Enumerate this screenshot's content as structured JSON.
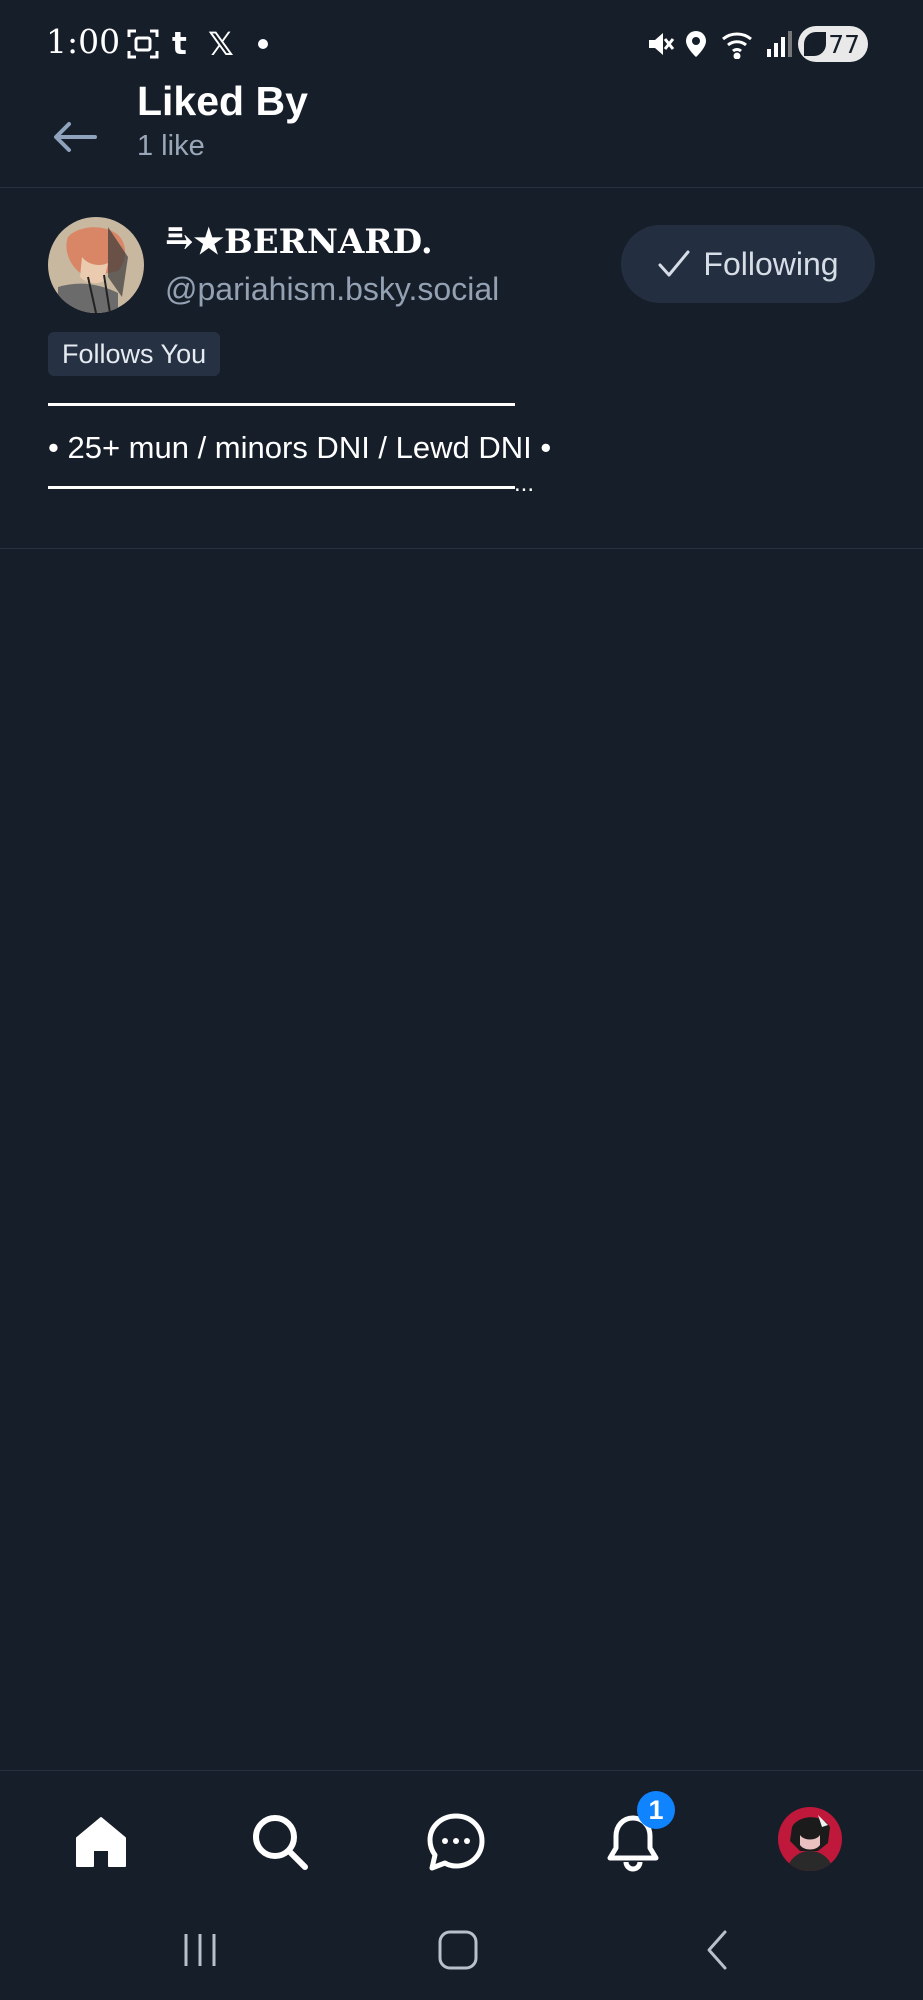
{
  "status_bar": {
    "time": "1:00",
    "battery": "77",
    "icons": [
      "screenshot-icon",
      "tumblr-icon",
      "x-icon",
      "notification-dot",
      "mute-icon",
      "location-icon",
      "wifi-icon",
      "signal-icon",
      "battery-icon"
    ]
  },
  "header": {
    "title": "Liked By",
    "subtitle": "1 like",
    "back_icon": "back-arrow-icon"
  },
  "user": {
    "display_name": "⥱★BERNARD.",
    "handle": "@pariahism.bsky.social",
    "follow_label": "Following",
    "badge": "Follows You",
    "bio_text": "• 25+ mun / minors DNI / Lewd DNI •",
    "bio_more": "..."
  },
  "bottom_nav": {
    "items": [
      "home-icon",
      "search-icon",
      "chat-icon",
      "bell-icon",
      "profile-avatar"
    ],
    "notification_count": "1"
  },
  "system_nav": [
    "recents-icon",
    "home-button-icon",
    "back-icon"
  ],
  "colors": {
    "background": "#161e29",
    "accent": "#1083fe",
    "muted_text": "#93a1b3",
    "button_bg": "#232f40"
  }
}
